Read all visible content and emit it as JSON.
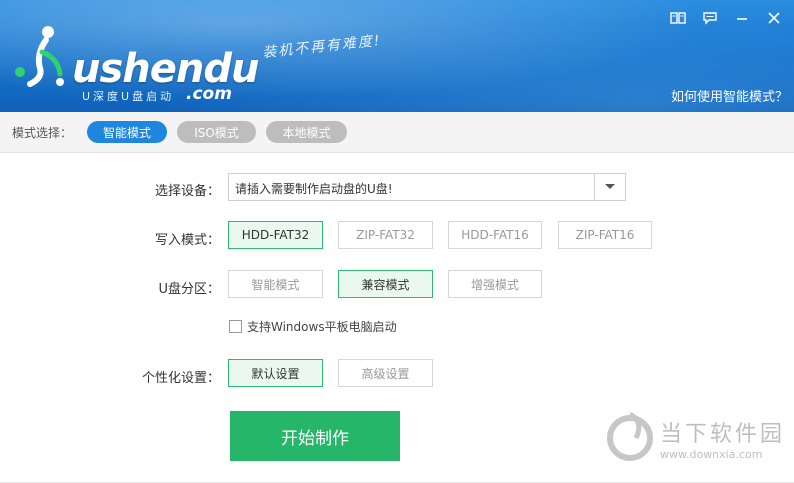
{
  "header": {
    "logo_main": "ushendu",
    "logo_sub": "U深度U盘启动",
    "logo_com": ".com",
    "slogan": "装机不再有难度!",
    "help_link": "如何使用智能模式？"
  },
  "window_controls": {
    "icons": [
      "book-icon",
      "feedback-icon",
      "minimize-icon",
      "close-icon"
    ]
  },
  "mode_bar": {
    "label": "模式选择：",
    "modes": [
      {
        "label": "智能模式",
        "active": true
      },
      {
        "label": "ISO模式",
        "active": false
      },
      {
        "label": "本地模式",
        "active": false
      }
    ]
  },
  "device": {
    "label": "选择设备：",
    "value": "请插入需要制作启动盘的U盘!"
  },
  "write_mode": {
    "label": "写入模式：",
    "options": [
      "HDD-FAT32",
      "ZIP-FAT32",
      "HDD-FAT16",
      "ZIP-FAT16"
    ],
    "selected": "HDD-FAT32"
  },
  "partition": {
    "label": "U盘分区：",
    "options": [
      "智能模式",
      "兼容模式",
      "增强模式"
    ],
    "selected": "兼容模式"
  },
  "tablet_checkbox": {
    "label": "支持Windows平板电脑启动",
    "checked": false
  },
  "personalize": {
    "label": "个性化设置：",
    "options": [
      "默认设置",
      "高级设置"
    ],
    "selected": "默认设置"
  },
  "start_button": {
    "label": "开始制作"
  },
  "watermark": {
    "text": "当下软件园",
    "url": "www.downxia.com"
  },
  "colors": {
    "header_blue": "#1977cf",
    "active_pill": "#1f86e0",
    "inactive_pill": "#bdbdbd",
    "selected_border": "#2cbb6f",
    "start_green": "#25b66a"
  }
}
